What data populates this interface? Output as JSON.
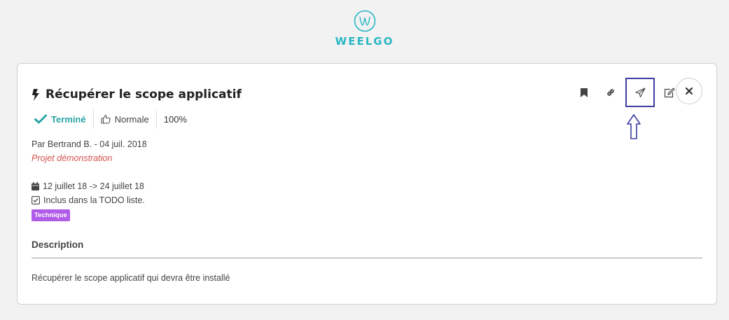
{
  "brand": {
    "name": "WEELGO",
    "color": "#2bb7c4"
  },
  "task": {
    "title": "Récupérer le scope applicatif",
    "status": "Terminé",
    "priority": "Normale",
    "progress": "100%",
    "author_line": "Par Bertrand B. - 04 juil. 2018",
    "project": "Projet démonstration",
    "dates": "12 juillet 18 -> 24 juillet 18",
    "todo": "Inclus dans la TODO liste.",
    "tag": "Technique",
    "description_title": "Description",
    "description": "Récupérer le scope applicatif qui devra être installé"
  },
  "actions": {
    "icons": [
      "bookmark-icon",
      "link-icon",
      "send-icon",
      "edit-icon",
      "close-icon"
    ],
    "highlighted": "send-icon",
    "highlight_color": "#3b3ea0"
  },
  "colors": {
    "status": "#2aa4a5",
    "project": "#d4524f",
    "tag": "#b05ce8"
  }
}
